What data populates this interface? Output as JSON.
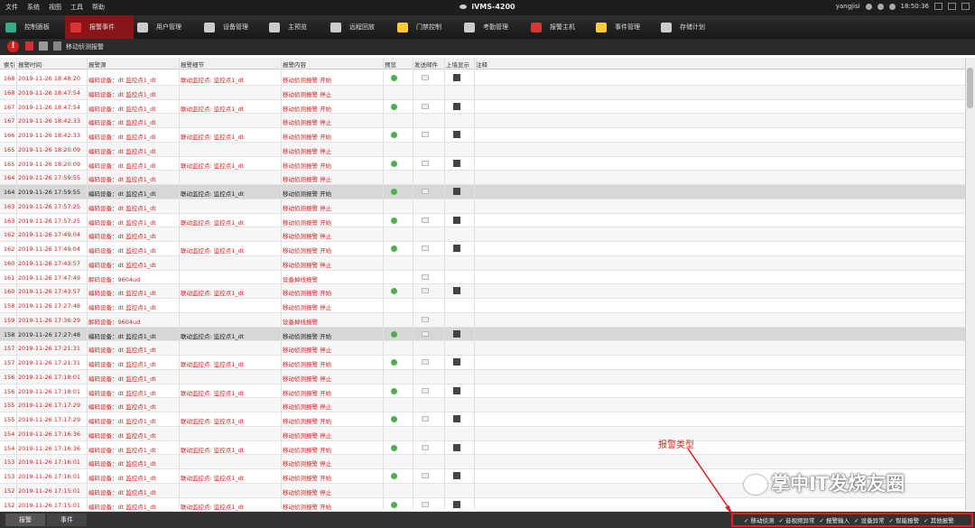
{
  "menubar": {
    "menus": [
      "文件",
      "系统",
      "视图",
      "工具",
      "帮助"
    ],
    "app_title": "iVMS-4200",
    "user": "yangjisi",
    "time": "18:50:36"
  },
  "modules": [
    {
      "label": "控制面板",
      "icon": "grid-icon",
      "active": false
    },
    {
      "label": "报警事件",
      "icon": "alarm-icon",
      "active": true
    },
    {
      "label": "用户管理",
      "icon": "user-icon",
      "active": false
    },
    {
      "label": "设备管理",
      "icon": "device-icon",
      "active": false
    },
    {
      "label": "主预览",
      "icon": "preview-icon",
      "active": false
    },
    {
      "label": "远程回放",
      "icon": "playback-icon",
      "active": false
    },
    {
      "label": "门禁控制",
      "icon": "door-icon",
      "active": false
    },
    {
      "label": "考勤管理",
      "icon": "attendance-icon",
      "active": false
    },
    {
      "label": "报警主机",
      "icon": "alarm-host-icon",
      "active": false
    },
    {
      "label": "事件管理",
      "icon": "event-icon",
      "active": false
    },
    {
      "label": "存储计划",
      "icon": "storage-icon",
      "active": false
    }
  ],
  "toolbar": {
    "label": "移动侦测报警"
  },
  "columns": [
    "索引",
    "报警时间",
    "报警源",
    "报警细节",
    "报警内容",
    "预览",
    "发送邮件",
    "上墙显示",
    "注释"
  ],
  "rows": [
    {
      "idx": "168",
      "time": "2019-11-26 18:48:20",
      "src": "编码设备：dt 监控点1_dt",
      "detail": "联动监控点: 监控点1_dt",
      "content": "移动侦测报警 开始",
      "preview": true,
      "mail": true,
      "wall": true,
      "color": "red",
      "sel": false
    },
    {
      "idx": "168",
      "time": "2019-11-26 18:47:54",
      "src": "编码设备：dt 监控点1_dt",
      "detail": "",
      "content": "移动侦测报警 停止",
      "preview": false,
      "mail": false,
      "wall": false,
      "color": "red",
      "sel": false
    },
    {
      "idx": "167",
      "time": "2019-11-26 18:47:54",
      "src": "编码设备：dt 监控点1_dt",
      "detail": "联动监控点: 监控点1_dt",
      "content": "移动侦测报警 开始",
      "preview": true,
      "mail": true,
      "wall": true,
      "color": "red",
      "sel": false
    },
    {
      "idx": "167",
      "time": "2019-11-26 18:42:33",
      "src": "编码设备：dt 监控点1_dt",
      "detail": "",
      "content": "移动侦测报警 停止",
      "preview": false,
      "mail": false,
      "wall": false,
      "color": "red",
      "sel": false
    },
    {
      "idx": "166",
      "time": "2019-11-26 18:42:33",
      "src": "编码设备：dt 监控点1_dt",
      "detail": "联动监控点: 监控点1_dt",
      "content": "移动侦测报警 开始",
      "preview": true,
      "mail": true,
      "wall": true,
      "color": "red",
      "sel": false
    },
    {
      "idx": "165",
      "time": "2019-11-26 18:20:09",
      "src": "编码设备：dt 监控点1_dt",
      "detail": "",
      "content": "移动侦测报警 停止",
      "preview": false,
      "mail": false,
      "wall": false,
      "color": "red",
      "sel": false
    },
    {
      "idx": "165",
      "time": "2019-11-26 18:20:09",
      "src": "编码设备：dt 监控点1_dt",
      "detail": "联动监控点: 监控点1_dt",
      "content": "移动侦测报警 开始",
      "preview": true,
      "mail": true,
      "wall": true,
      "color": "red",
      "sel": false
    },
    {
      "idx": "164",
      "time": "2019-11-26 17:59:55",
      "src": "编码设备：dt 监控点1_dt",
      "detail": "",
      "content": "移动侦测报警 停止",
      "preview": false,
      "mail": false,
      "wall": false,
      "color": "red",
      "sel": false
    },
    {
      "idx": "164",
      "time": "2019-11-26 17:59:55",
      "src": "编码设备：dt 监控点1_dt",
      "detail": "联动监控点: 监控点1_dt",
      "content": "移动侦测报警 开始",
      "preview": true,
      "mail": true,
      "wall": true,
      "color": "black",
      "sel": true
    },
    {
      "idx": "163",
      "time": "2019-11-26 17:57:25",
      "src": "编码设备：dt 监控点1_dt",
      "detail": "",
      "content": "移动侦测报警 停止",
      "preview": false,
      "mail": false,
      "wall": false,
      "color": "red",
      "sel": false
    },
    {
      "idx": "163",
      "time": "2019-11-26 17:57:25",
      "src": "编码设备：dt 监控点1_dt",
      "detail": "联动监控点: 监控点1_dt",
      "content": "移动侦测报警 开始",
      "preview": true,
      "mail": true,
      "wall": true,
      "color": "red",
      "sel": false
    },
    {
      "idx": "162",
      "time": "2019-11-26 17:49:04",
      "src": "编码设备：dt 监控点1_dt",
      "detail": "",
      "content": "移动侦测报警 停止",
      "preview": false,
      "mail": false,
      "wall": false,
      "color": "red",
      "sel": false
    },
    {
      "idx": "162",
      "time": "2019-11-26 17:49:04",
      "src": "编码设备：dt 监控点1_dt",
      "detail": "联动监控点: 监控点1_dt",
      "content": "移动侦测报警 开始",
      "preview": true,
      "mail": true,
      "wall": true,
      "color": "red",
      "sel": false
    },
    {
      "idx": "160",
      "time": "2019-11-26 17:43:57",
      "src": "编码设备：dt 监控点1_dt",
      "detail": "",
      "content": "移动侦测报警 停止",
      "preview": false,
      "mail": false,
      "wall": false,
      "color": "red",
      "sel": false
    },
    {
      "idx": "161",
      "time": "2019-11-26 17:47:49",
      "src": "解码设备：9604ud",
      "detail": "",
      "content": "设备掉线报警",
      "preview": false,
      "mail": true,
      "wall": false,
      "color": "red",
      "sel": false
    },
    {
      "idx": "160",
      "time": "2019-11-26 17:43:57",
      "src": "编码设备：dt 监控点1_dt",
      "detail": "联动监控点: 监控点1_dt",
      "content": "移动侦测报警 开始",
      "preview": true,
      "mail": true,
      "wall": true,
      "color": "red",
      "sel": false
    },
    {
      "idx": "158",
      "time": "2019-11-26 17:27:48",
      "src": "编码设备：dt 监控点1_dt",
      "detail": "",
      "content": "移动侦测报警 停止",
      "preview": false,
      "mail": false,
      "wall": false,
      "color": "red",
      "sel": false
    },
    {
      "idx": "159",
      "time": "2019-11-26 17:36:29",
      "src": "解码设备：9604ud",
      "detail": "",
      "content": "设备掉线报警",
      "preview": false,
      "mail": true,
      "wall": false,
      "color": "red",
      "sel": false
    },
    {
      "idx": "158",
      "time": "2019-11-26 17:27:48",
      "src": "编码设备：dt 监控点1_dt",
      "detail": "联动监控点: 监控点1_dt",
      "content": "移动侦测报警 开始",
      "preview": true,
      "mail": true,
      "wall": true,
      "color": "black",
      "sel": true
    },
    {
      "idx": "157",
      "time": "2019-11-26 17:21:31",
      "src": "编码设备：dt 监控点1_dt",
      "detail": "",
      "content": "移动侦测报警 停止",
      "preview": false,
      "mail": false,
      "wall": false,
      "color": "red",
      "sel": false
    },
    {
      "idx": "157",
      "time": "2019-11-26 17:21:31",
      "src": "编码设备：dt 监控点1_dt",
      "detail": "联动监控点: 监控点1_dt",
      "content": "移动侦测报警 开始",
      "preview": true,
      "mail": true,
      "wall": true,
      "color": "red",
      "sel": false
    },
    {
      "idx": "156",
      "time": "2019-11-26 17:18:01",
      "src": "编码设备：dt 监控点1_dt",
      "detail": "",
      "content": "移动侦测报警 停止",
      "preview": false,
      "mail": false,
      "wall": false,
      "color": "red",
      "sel": false
    },
    {
      "idx": "156",
      "time": "2019-11-26 17:18:01",
      "src": "编码设备：dt 监控点1_dt",
      "detail": "联动监控点: 监控点1_dt",
      "content": "移动侦测报警 开始",
      "preview": true,
      "mail": true,
      "wall": true,
      "color": "red",
      "sel": false
    },
    {
      "idx": "155",
      "time": "2019-11-26 17:17:29",
      "src": "编码设备：dt 监控点1_dt",
      "detail": "",
      "content": "移动侦测报警 停止",
      "preview": false,
      "mail": false,
      "wall": false,
      "color": "red",
      "sel": false
    },
    {
      "idx": "155",
      "time": "2019-11-26 17:17:29",
      "src": "编码设备：dt 监控点1_dt",
      "detail": "联动监控点: 监控点1_dt",
      "content": "移动侦测报警 开始",
      "preview": true,
      "mail": true,
      "wall": true,
      "color": "red",
      "sel": false
    },
    {
      "idx": "154",
      "time": "2019-11-26 17:16:36",
      "src": "编码设备：dt 监控点1_dt",
      "detail": "",
      "content": "移动侦测报警 停止",
      "preview": false,
      "mail": false,
      "wall": false,
      "color": "red",
      "sel": false
    },
    {
      "idx": "154",
      "time": "2019-11-26 17:16:36",
      "src": "编码设备：dt 监控点1_dt",
      "detail": "联动监控点: 监控点1_dt",
      "content": "移动侦测报警 开始",
      "preview": true,
      "mail": true,
      "wall": true,
      "color": "red",
      "sel": false
    },
    {
      "idx": "153",
      "time": "2019-11-26 17:16:01",
      "src": "编码设备：dt 监控点1_dt",
      "detail": "",
      "content": "移动侦测报警 停止",
      "preview": false,
      "mail": false,
      "wall": false,
      "color": "red",
      "sel": false
    },
    {
      "idx": "153",
      "time": "2019-11-26 17:16:01",
      "src": "编码设备：dt 监控点1_dt",
      "detail": "联动监控点: 监控点1_dt",
      "content": "移动侦测报警 开始",
      "preview": true,
      "mail": true,
      "wall": true,
      "color": "red",
      "sel": false
    },
    {
      "idx": "152",
      "time": "2019-11-26 17:15:01",
      "src": "编码设备：dt 监控点1_dt",
      "detail": "",
      "content": "移动侦测报警 停止",
      "preview": false,
      "mail": false,
      "wall": false,
      "color": "red",
      "sel": false
    },
    {
      "idx": "152",
      "time": "2019-11-26 17:15:01",
      "src": "编码设备：dt 监控点1_dt",
      "detail": "联动监控点: 监控点1_dt",
      "content": "移动侦测报警 开始",
      "preview": true,
      "mail": true,
      "wall": true,
      "color": "red",
      "sel": false
    }
  ],
  "bottom": {
    "tabs": [
      "报警",
      "事件"
    ],
    "filters": [
      "移动侦测",
      "音视频异常",
      "报警输入",
      "设备异常",
      "智能报警",
      "其他报警"
    ]
  },
  "annotation": {
    "label": "报警类型",
    "color": "#e02020"
  },
  "watermark": "掌中IT发烧友圈"
}
